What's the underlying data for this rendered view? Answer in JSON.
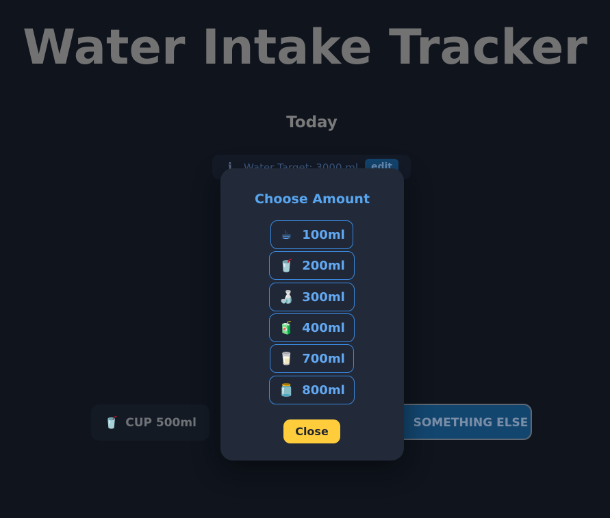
{
  "page": {
    "title": "Water Intake Tracker",
    "subtitle": "Today"
  },
  "target": {
    "icon": "info-icon",
    "label": "Water Target: 3000 ml",
    "edit_label": "edit"
  },
  "quick_buttons": [
    {
      "icon": "cup-icon",
      "label": "CUP 500ml"
    },
    {
      "label": "SOMETHING ELSE"
    }
  ],
  "modal": {
    "title": "Choose Amount",
    "options": [
      {
        "icon": "coffee-icon",
        "glyph": "☕",
        "label": "100ml"
      },
      {
        "icon": "cup-icon",
        "glyph": "🥤",
        "label": "200ml"
      },
      {
        "icon": "bottle-icon",
        "glyph": "🍶",
        "label": "300ml"
      },
      {
        "icon": "juice-box-icon",
        "glyph": "🧃",
        "label": "400ml"
      },
      {
        "icon": "glass-icon",
        "glyph": "🥛",
        "label": "700ml"
      },
      {
        "icon": "jar-icon",
        "glyph": "🫙",
        "label": "800ml"
      }
    ],
    "close_label": "Close"
  }
}
